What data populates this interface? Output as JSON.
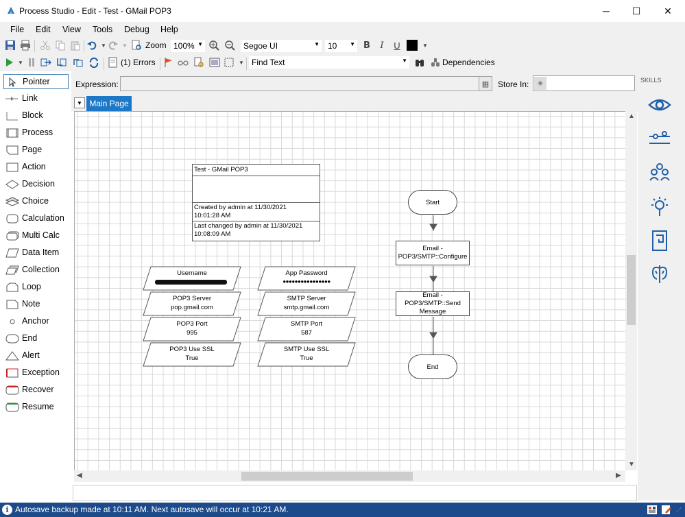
{
  "window": {
    "title": "Process Studio  - Edit - Test - GMail POP3",
    "minimize": "─",
    "maximize": "☐",
    "close": "✕"
  },
  "menu": [
    "File",
    "Edit",
    "View",
    "Tools",
    "Debug",
    "Help"
  ],
  "toolbar1": {
    "zoom_label": "Zoom",
    "zoom_value": "100%",
    "font_name": "Segoe UI",
    "font_size": "10",
    "bold": "B",
    "italic": "I",
    "underline": "U",
    "text_color": "#000000"
  },
  "toolbar2": {
    "errors_label": "(1) Errors",
    "find_text_label": "Find Text",
    "dependencies_label": "Dependencies"
  },
  "palette": {
    "items": [
      {
        "label": "Pointer",
        "icon": "pointer-icon"
      },
      {
        "label": "Link",
        "icon": "link-icon"
      },
      {
        "label": "Block",
        "icon": "block-icon"
      },
      {
        "label": "Process",
        "icon": "process-icon"
      },
      {
        "label": "Page",
        "icon": "page-icon"
      },
      {
        "label": "Action",
        "icon": "action-icon"
      },
      {
        "label": "Decision",
        "icon": "decision-icon"
      },
      {
        "label": "Choice",
        "icon": "choice-icon"
      },
      {
        "label": "Calculation",
        "icon": "calculation-icon"
      },
      {
        "label": "Multi Calc",
        "icon": "multi-calc-icon"
      },
      {
        "label": "Data Item",
        "icon": "data-item-icon"
      },
      {
        "label": "Collection",
        "icon": "collection-icon"
      },
      {
        "label": "Loop",
        "icon": "loop-icon"
      },
      {
        "label": "Note",
        "icon": "note-icon"
      },
      {
        "label": "Anchor",
        "icon": "anchor-icon"
      },
      {
        "label": "End",
        "icon": "end-icon"
      },
      {
        "label": "Alert",
        "icon": "alert-icon"
      },
      {
        "label": "Exception",
        "icon": "exception-icon"
      },
      {
        "label": "Recover",
        "icon": "recover-icon"
      },
      {
        "label": "Resume",
        "icon": "resume-icon"
      }
    ],
    "selected": "Pointer"
  },
  "expression": {
    "label": "Expression:",
    "value": "",
    "store_in_label": "Store In:",
    "store_in_value": ""
  },
  "tabs": {
    "active": "Main Page"
  },
  "skills": {
    "label": "SKILLS"
  },
  "diagram": {
    "info": {
      "title": "Test - GMail POP3",
      "created_line1": "Created by admin at 11/30/2021",
      "created_line2": "10:01:28 AM",
      "changed_line1": "Last changed by admin at 11/30/2021",
      "changed_line2": "10:08:09 AM"
    },
    "data_items": [
      {
        "name": "Username",
        "value": "",
        "redacted": true
      },
      {
        "name": "App Password",
        "value": "●●●●●●●●●●●●●●●●"
      },
      {
        "name": "POP3 Server",
        "value": "pop.gmail.com"
      },
      {
        "name": "SMTP Server",
        "value": "smtp.gmail.com"
      },
      {
        "name": "POP3 Port",
        "value": "995"
      },
      {
        "name": "SMTP Port",
        "value": "587"
      },
      {
        "name": "POP3 Use SSL",
        "value": "True"
      },
      {
        "name": "SMTP Use SSL",
        "value": "True"
      }
    ],
    "flow": {
      "start": "Start",
      "action1_line1": "Email -",
      "action1_line2": "POP3/SMTP::Configure",
      "action2_line1": "Email -",
      "action2_line2": "POP3/SMTP::Send",
      "action2_line3": "Message",
      "end": "End"
    }
  },
  "status": {
    "text": "Autosave backup made at 10:11 AM. Next autosave will occur at 10:21 AM.",
    "info_glyph": "i"
  },
  "colors": {
    "status_bg": "#1d4a8a",
    "tab_active": "#1e78c8",
    "skill_icon": "#1f5fa8"
  }
}
